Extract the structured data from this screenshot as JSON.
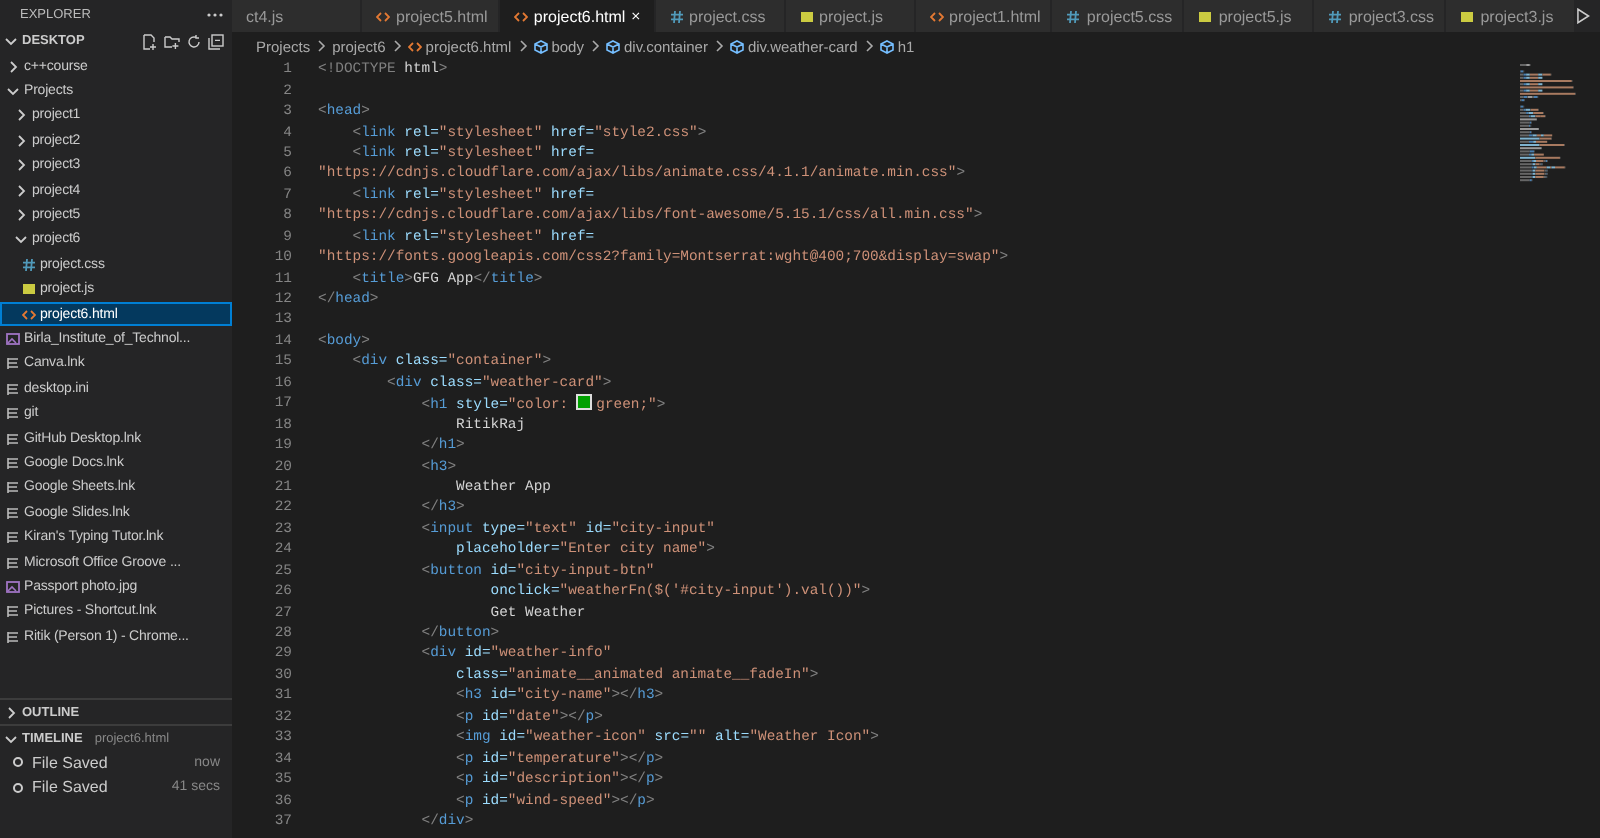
{
  "explorer": {
    "title": "EXPLORER",
    "section": {
      "title": "DESKTOP",
      "expanded": true
    },
    "tree": [
      {
        "label": "c++course",
        "kind": "folder",
        "expanded": false,
        "selected": false
      },
      {
        "label": "Projects",
        "kind": "folder",
        "expanded": true,
        "selected": false,
        "children": [
          {
            "label": "project1",
            "kind": "folder",
            "expanded": false,
            "selected": false
          },
          {
            "label": "project2",
            "kind": "folder",
            "expanded": false,
            "selected": false
          },
          {
            "label": "project3",
            "kind": "folder",
            "expanded": false,
            "selected": false
          },
          {
            "label": "project4",
            "kind": "folder",
            "expanded": false,
            "selected": false
          },
          {
            "label": "project5",
            "kind": "folder",
            "expanded": false,
            "selected": false
          },
          {
            "label": "project6",
            "kind": "folder",
            "expanded": true,
            "selected": false,
            "children": [
              {
                "label": "project.css",
                "kind": "css",
                "selected": false
              },
              {
                "label": "project.js",
                "kind": "js",
                "selected": false
              },
              {
                "label": "project6.html",
                "kind": "html",
                "selected": true
              }
            ]
          }
        ]
      },
      {
        "label": "Birla_Institute_of_Technol...",
        "kind": "image",
        "selected": false
      },
      {
        "label": "Canva.lnk",
        "kind": "shortcut",
        "selected": false
      },
      {
        "label": "desktop.ini",
        "kind": "shortcut",
        "selected": false
      },
      {
        "label": "git",
        "kind": "shortcut",
        "selected": false
      },
      {
        "label": "GitHub Desktop.lnk",
        "kind": "shortcut",
        "selected": false
      },
      {
        "label": "Google Docs.lnk",
        "kind": "shortcut",
        "selected": false
      },
      {
        "label": "Google Sheets.lnk",
        "kind": "shortcut",
        "selected": false
      },
      {
        "label": "Google Slides.lnk",
        "kind": "shortcut",
        "selected": false
      },
      {
        "label": "Kiran's Typing Tutor.lnk",
        "kind": "shortcut",
        "selected": false
      },
      {
        "label": "Microsoft Office Groove ...",
        "kind": "shortcut",
        "selected": false
      },
      {
        "label": "Passport photo.jpg",
        "kind": "image",
        "selected": false
      },
      {
        "label": "Pictures - Shortcut.lnk",
        "kind": "shortcut",
        "selected": false
      },
      {
        "label": "Ritik (Person 1) - Chrome...",
        "kind": "shortcut",
        "selected": false
      }
    ]
  },
  "outline": {
    "title": "OUTLINE",
    "expanded": false
  },
  "timeline": {
    "title": "TIMELINE",
    "expanded": true,
    "file": "project6.html",
    "entries": [
      {
        "label": "File Saved",
        "time": "now"
      },
      {
        "label": "File Saved",
        "time": "41 secs"
      }
    ]
  },
  "tabs": [
    {
      "label": "ct4.js",
      "kind": "clipped",
      "selected": false
    },
    {
      "label": "project5.html",
      "kind": "html",
      "selected": false
    },
    {
      "label": "project6.html",
      "kind": "html",
      "selected": true
    },
    {
      "label": "project.css",
      "kind": "css",
      "selected": false
    },
    {
      "label": "project.js",
      "kind": "js",
      "selected": false
    },
    {
      "label": "project1.html",
      "kind": "html",
      "selected": false
    },
    {
      "label": "project5.css",
      "kind": "css",
      "selected": false
    },
    {
      "label": "project5.js",
      "kind": "js",
      "selected": false
    },
    {
      "label": "project3.css",
      "kind": "css",
      "selected": false
    },
    {
      "label": "project3.js",
      "kind": "js",
      "selected": false
    }
  ],
  "breadcrumb": [
    {
      "label": "Projects",
      "kind": "folder"
    },
    {
      "label": "project6",
      "kind": "folder"
    },
    {
      "label": "project6.html",
      "kind": "html"
    },
    {
      "label": "body",
      "kind": "element"
    },
    {
      "label": "div.container",
      "kind": "element"
    },
    {
      "label": "div.weather-card",
      "kind": "element"
    },
    {
      "label": "h1",
      "kind": "element"
    }
  ],
  "code": [
    {
      "number": "1",
      "tokens": [
        {
          "kind": "punct",
          "text": "<!DOCTYPE"
        },
        {
          "kind": "plain",
          "text": " html"
        },
        {
          "kind": "punct",
          "text": ">"
        }
      ]
    },
    {
      "number": "2"
    },
    {
      "number": "3",
      "tokens": [
        {
          "kind": "punct",
          "text": "<"
        },
        {
          "kind": "tag",
          "text": "head"
        },
        {
          "kind": "punct",
          "text": ">"
        }
      ]
    },
    {
      "number": "4",
      "tokens": [
        {
          "kind": "punct",
          "text": "    <"
        },
        {
          "kind": "tag",
          "text": "link"
        },
        {
          "kind": "attr",
          "text": " rel="
        },
        {
          "kind": "string",
          "text": "\"stylesheet\""
        },
        {
          "kind": "attr",
          "text": " href="
        },
        {
          "kind": "string",
          "text": "\"style2.css\""
        },
        {
          "kind": "punct",
          "text": ">"
        }
      ]
    },
    {
      "number": "5",
      "tokens": [
        {
          "kind": "punct",
          "text": "    <"
        },
        {
          "kind": "tag",
          "text": "link"
        },
        {
          "kind": "attr",
          "text": " rel="
        },
        {
          "kind": "string",
          "text": "\"stylesheet\""
        },
        {
          "kind": "attr",
          "text": " href="
        }
      ]
    },
    {
      "number": "6",
      "tokens": [
        {
          "kind": "string",
          "text": "\"https://cdnjs.cloudflare.com/ajax/libs/animate.css/4.1.1/animate.min.css\""
        },
        {
          "kind": "punct",
          "text": ">"
        }
      ]
    },
    {
      "number": "7",
      "tokens": [
        {
          "kind": "punct",
          "text": "    <"
        },
        {
          "kind": "tag",
          "text": "link"
        },
        {
          "kind": "attr",
          "text": " rel="
        },
        {
          "kind": "string",
          "text": "\"stylesheet\""
        },
        {
          "kind": "attr",
          "text": " href="
        }
      ]
    },
    {
      "number": "8",
      "tokens": [
        {
          "kind": "string",
          "text": "\"https://cdnjs.cloudflare.com/ajax/libs/font-awesome/5.15.1/css/all.min.css\""
        },
        {
          "kind": "punct",
          "text": ">"
        }
      ]
    },
    {
      "number": "9",
      "tokens": [
        {
          "kind": "punct",
          "text": "    <"
        },
        {
          "kind": "tag",
          "text": "link"
        },
        {
          "kind": "attr",
          "text": " rel="
        },
        {
          "kind": "string",
          "text": "\"stylesheet\""
        },
        {
          "kind": "attr",
          "text": " href="
        }
      ]
    },
    {
      "number": "10",
      "tokens": [
        {
          "kind": "string",
          "text": "\"https://fonts.googleapis.com/css2?family=Montserrat:wght@400;700&display=swap\""
        },
        {
          "kind": "punct",
          "text": ">"
        }
      ]
    },
    {
      "number": "11",
      "tokens": [
        {
          "kind": "punct",
          "text": "    <"
        },
        {
          "kind": "tag",
          "text": "title"
        },
        {
          "kind": "punct",
          "text": ">"
        },
        {
          "kind": "plain",
          "text": "GFG App"
        },
        {
          "kind": "punct",
          "text": "</"
        },
        {
          "kind": "tag",
          "text": "title"
        },
        {
          "kind": "punct",
          "text": ">"
        }
      ]
    },
    {
      "number": "12",
      "tokens": [
        {
          "kind": "punct",
          "text": "</"
        },
        {
          "kind": "tag",
          "text": "head"
        },
        {
          "kind": "punct",
          "text": ">"
        }
      ]
    },
    {
      "number": "13"
    },
    {
      "number": "14",
      "tokens": [
        {
          "kind": "punct",
          "text": "<"
        },
        {
          "kind": "tag",
          "text": "body"
        },
        {
          "kind": "punct",
          "text": ">"
        }
      ]
    },
    {
      "number": "15",
      "tokens": [
        {
          "kind": "punct",
          "text": "    <"
        },
        {
          "kind": "tag",
          "text": "div"
        },
        {
          "kind": "attr",
          "text": " class="
        },
        {
          "kind": "string",
          "text": "\"container\""
        },
        {
          "kind": "punct",
          "text": ">"
        }
      ]
    },
    {
      "number": "16",
      "tokens": [
        {
          "kind": "punct",
          "text": "        <"
        },
        {
          "kind": "tag",
          "text": "div"
        },
        {
          "kind": "attr",
          "text": " class="
        },
        {
          "kind": "string",
          "text": "\"weather-card\""
        },
        {
          "kind": "punct",
          "text": ">"
        }
      ]
    },
    {
      "number": "17",
      "tokens": [
        {
          "kind": "punct",
          "text": "            <"
        },
        {
          "kind": "tag",
          "text": "h1"
        },
        {
          "kind": "attr",
          "text": " style="
        },
        {
          "kind": "string",
          "text": "\"color:"
        },
        {
          "kind": "swatch",
          "color": "#00a000"
        },
        {
          "kind": "string",
          "text": "green;\""
        },
        {
          "kind": "punct",
          "text": ">"
        }
      ]
    },
    {
      "number": "18",
      "tokens": [
        {
          "kind": "plain",
          "text": "                RitikRaj"
        }
      ]
    },
    {
      "number": "19",
      "tokens": [
        {
          "kind": "punct",
          "text": "            </"
        },
        {
          "kind": "tag",
          "text": "h1"
        },
        {
          "kind": "punct",
          "text": ">"
        }
      ]
    },
    {
      "number": "20",
      "tokens": [
        {
          "kind": "punct",
          "text": "            <"
        },
        {
          "kind": "tag",
          "text": "h3"
        },
        {
          "kind": "punct",
          "text": ">"
        }
      ]
    },
    {
      "number": "21",
      "tokens": [
        {
          "kind": "plain",
          "text": "                Weather App"
        }
      ]
    },
    {
      "number": "22",
      "tokens": [
        {
          "kind": "punct",
          "text": "            </"
        },
        {
          "kind": "tag",
          "text": "h3"
        },
        {
          "kind": "punct",
          "text": ">"
        }
      ]
    },
    {
      "number": "23",
      "tokens": [
        {
          "kind": "punct",
          "text": "            <"
        },
        {
          "kind": "tag",
          "text": "input"
        },
        {
          "kind": "attr",
          "text": " type="
        },
        {
          "kind": "string",
          "text": "\"text\""
        },
        {
          "kind": "attr",
          "text": " id="
        },
        {
          "kind": "string",
          "text": "\"city-input\""
        }
      ]
    },
    {
      "number": "24",
      "tokens": [
        {
          "kind": "attr",
          "text": "                placeholder="
        },
        {
          "kind": "string",
          "text": "\"Enter city name\""
        },
        {
          "kind": "punct",
          "text": ">"
        }
      ]
    },
    {
      "number": "25",
      "tokens": [
        {
          "kind": "punct",
          "text": "            <"
        },
        {
          "kind": "tag",
          "text": "button"
        },
        {
          "kind": "attr",
          "text": " id="
        },
        {
          "kind": "string",
          "text": "\"city-input-btn\""
        }
      ]
    },
    {
      "number": "26",
      "tokens": [
        {
          "kind": "attr",
          "text": "                    onclick="
        },
        {
          "kind": "string",
          "text": "\"weatherFn($('#city-input').val())\""
        },
        {
          "kind": "punct",
          "text": ">"
        }
      ]
    },
    {
      "number": "27",
      "tokens": [
        {
          "kind": "plain",
          "text": "                    Get Weather"
        }
      ]
    },
    {
      "number": "28",
      "tokens": [
        {
          "kind": "punct",
          "text": "            </"
        },
        {
          "kind": "tag",
          "text": "button"
        },
        {
          "kind": "punct",
          "text": ">"
        }
      ]
    },
    {
      "number": "29",
      "tokens": [
        {
          "kind": "punct",
          "text": "            <"
        },
        {
          "kind": "tag",
          "text": "div"
        },
        {
          "kind": "attr",
          "text": " id="
        },
        {
          "kind": "string",
          "text": "\"weather-info\""
        }
      ]
    },
    {
      "number": "30",
      "tokens": [
        {
          "kind": "attr",
          "text": "                class="
        },
        {
          "kind": "string",
          "text": "\"animate__animated animate__fadeIn\""
        },
        {
          "kind": "punct",
          "text": ">"
        }
      ]
    },
    {
      "number": "31",
      "tokens": [
        {
          "kind": "punct",
          "text": "                <"
        },
        {
          "kind": "tag",
          "text": "h3"
        },
        {
          "kind": "attr",
          "text": " id="
        },
        {
          "kind": "string",
          "text": "\"city-name\""
        },
        {
          "kind": "punct",
          "text": "></"
        },
        {
          "kind": "tag",
          "text": "h3"
        },
        {
          "kind": "punct",
          "text": ">"
        }
      ]
    },
    {
      "number": "32",
      "tokens": [
        {
          "kind": "punct",
          "text": "                <"
        },
        {
          "kind": "tag",
          "text": "p"
        },
        {
          "kind": "attr",
          "text": " id="
        },
        {
          "kind": "string",
          "text": "\"date\""
        },
        {
          "kind": "punct",
          "text": "></"
        },
        {
          "kind": "tag",
          "text": "p"
        },
        {
          "kind": "punct",
          "text": ">"
        }
      ]
    },
    {
      "number": "33",
      "tokens": [
        {
          "kind": "punct",
          "text": "                <"
        },
        {
          "kind": "tag",
          "text": "img"
        },
        {
          "kind": "attr",
          "text": " id="
        },
        {
          "kind": "string",
          "text": "\"weather-icon\""
        },
        {
          "kind": "attr",
          "text": " src="
        },
        {
          "kind": "string",
          "text": "\"\""
        },
        {
          "kind": "attr",
          "text": " alt="
        },
        {
          "kind": "string",
          "text": "\"Weather Icon\""
        },
        {
          "kind": "punct",
          "text": ">"
        }
      ]
    },
    {
      "number": "34",
      "tokens": [
        {
          "kind": "punct",
          "text": "                <"
        },
        {
          "kind": "tag",
          "text": "p"
        },
        {
          "kind": "attr",
          "text": " id="
        },
        {
          "kind": "string",
          "text": "\"temperature\""
        },
        {
          "kind": "punct",
          "text": "></"
        },
        {
          "kind": "tag",
          "text": "p"
        },
        {
          "kind": "punct",
          "text": ">"
        }
      ]
    },
    {
      "number": "35",
      "tokens": [
        {
          "kind": "punct",
          "text": "                <"
        },
        {
          "kind": "tag",
          "text": "p"
        },
        {
          "kind": "attr",
          "text": " id="
        },
        {
          "kind": "string",
          "text": "\"description\""
        },
        {
          "kind": "punct",
          "text": "></"
        },
        {
          "kind": "tag",
          "text": "p"
        },
        {
          "kind": "punct",
          "text": ">"
        }
      ]
    },
    {
      "number": "36",
      "tokens": [
        {
          "kind": "punct",
          "text": "                <"
        },
        {
          "kind": "tag",
          "text": "p"
        },
        {
          "kind": "attr",
          "text": " id="
        },
        {
          "kind": "string",
          "text": "\"wind-speed\""
        },
        {
          "kind": "punct",
          "text": "></"
        },
        {
          "kind": "tag",
          "text": "p"
        },
        {
          "kind": "punct",
          "text": ">"
        }
      ]
    },
    {
      "number": "37",
      "tokens": [
        {
          "kind": "punct",
          "text": "            </"
        },
        {
          "kind": "tag",
          "text": "div"
        },
        {
          "kind": "punct",
          "text": ">"
        }
      ]
    }
  ]
}
